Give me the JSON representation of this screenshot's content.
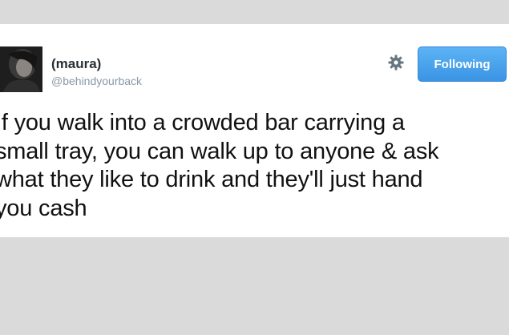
{
  "tweet": {
    "author": {
      "display_name": "(maura)",
      "handle": "@behindyourback",
      "avatar_icon": "profile-photo"
    },
    "actions": {
      "settings_icon": "gear-icon",
      "follow_label": "Following"
    },
    "text": "If you walk into a crowded bar carrying a\nsmall tray, you can walk up to anyone & ask\nwhat they like to drink and they'll just hand\nyou cash"
  },
  "colors": {
    "page_background": "#dadada",
    "card_background": "#ffffff",
    "follow_button": "#4aa3ef",
    "handle_text": "#8899a6"
  }
}
